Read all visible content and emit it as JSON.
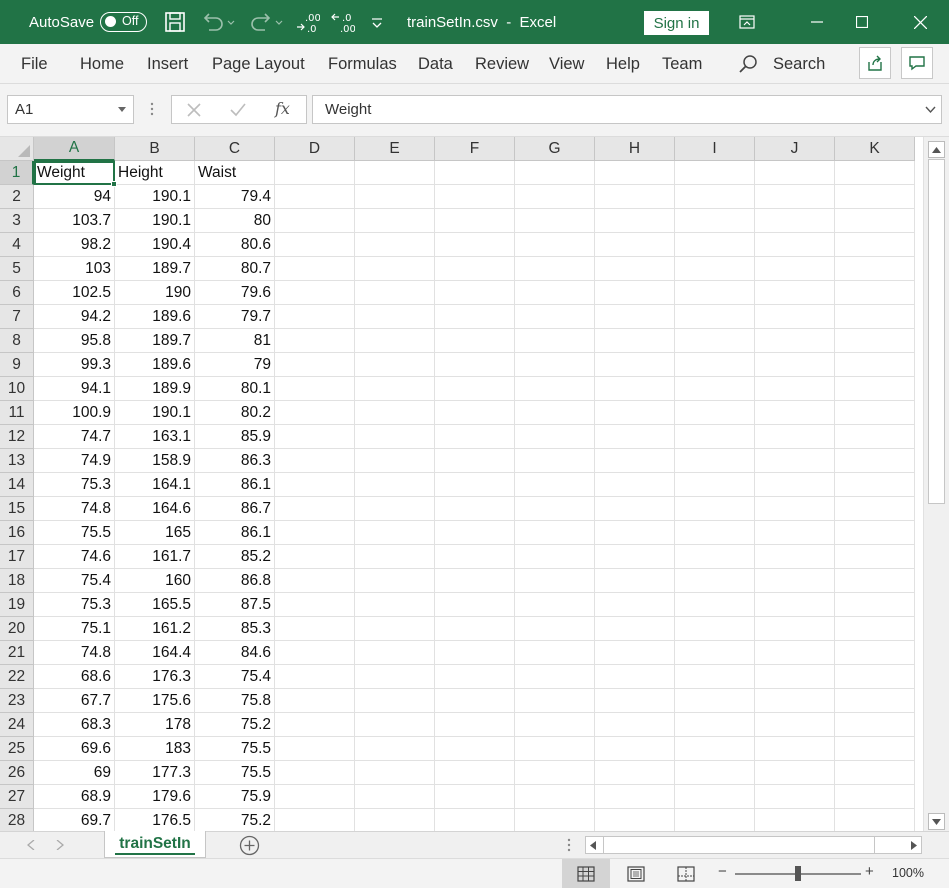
{
  "titlebar": {
    "autosave_label": "AutoSave",
    "autosave_state": "Off",
    "document_title": "trainSetIn.csv  -  Excel",
    "sign_in": "Sign in",
    "accent_color": "#217346"
  },
  "ribbon": {
    "tabs": [
      "File",
      "Home",
      "Insert",
      "Page Layout",
      "Formulas",
      "Data",
      "Review",
      "View",
      "Help",
      "Team"
    ],
    "search_label": "Search"
  },
  "formula_bar": {
    "name_box": "A1",
    "fx_label": "fx",
    "content": "Weight"
  },
  "sheet": {
    "columns": [
      "A",
      "B",
      "C",
      "D",
      "E",
      "F",
      "G",
      "H",
      "I",
      "J",
      "K"
    ],
    "row_numbers": [
      "1",
      "2",
      "3",
      "4",
      "5",
      "6",
      "7",
      "8",
      "9",
      "10",
      "11",
      "12",
      "13",
      "14",
      "15",
      "16",
      "17",
      "18",
      "19",
      "20",
      "21",
      "22",
      "23",
      "24",
      "25",
      "26",
      "27",
      "28"
    ],
    "rows": [
      [
        "Weight",
        "Height",
        "Waist"
      ],
      [
        "94",
        "190.1",
        "79.4"
      ],
      [
        "103.7",
        "190.1",
        "80"
      ],
      [
        "98.2",
        "190.4",
        "80.6"
      ],
      [
        "103",
        "189.7",
        "80.7"
      ],
      [
        "102.5",
        "190",
        "79.6"
      ],
      [
        "94.2",
        "189.6",
        "79.7"
      ],
      [
        "95.8",
        "189.7",
        "81"
      ],
      [
        "99.3",
        "189.6",
        "79"
      ],
      [
        "94.1",
        "189.9",
        "80.1"
      ],
      [
        "100.9",
        "190.1",
        "80.2"
      ],
      [
        "74.7",
        "163.1",
        "85.9"
      ],
      [
        "74.9",
        "158.9",
        "86.3"
      ],
      [
        "75.3",
        "164.1",
        "86.1"
      ],
      [
        "74.8",
        "164.6",
        "86.7"
      ],
      [
        "75.5",
        "165",
        "86.1"
      ],
      [
        "74.6",
        "161.7",
        "85.2"
      ],
      [
        "75.4",
        "160",
        "86.8"
      ],
      [
        "75.3",
        "165.5",
        "87.5"
      ],
      [
        "75.1",
        "161.2",
        "85.3"
      ],
      [
        "74.8",
        "164.4",
        "84.6"
      ],
      [
        "68.6",
        "176.3",
        "75.4"
      ],
      [
        "67.7",
        "175.6",
        "75.8"
      ],
      [
        "68.3",
        "178",
        "75.2"
      ],
      [
        "69.6",
        "183",
        "75.5"
      ],
      [
        "69",
        "177.3",
        "75.5"
      ],
      [
        "68.9",
        "179.6",
        "75.9"
      ],
      [
        "69.7",
        "176.5",
        "75.2"
      ]
    ],
    "active_cell": "A1",
    "tab_name": "trainSetIn"
  },
  "status_bar": {
    "zoom": "100%",
    "zoom_minus": "−",
    "zoom_plus": "+"
  }
}
